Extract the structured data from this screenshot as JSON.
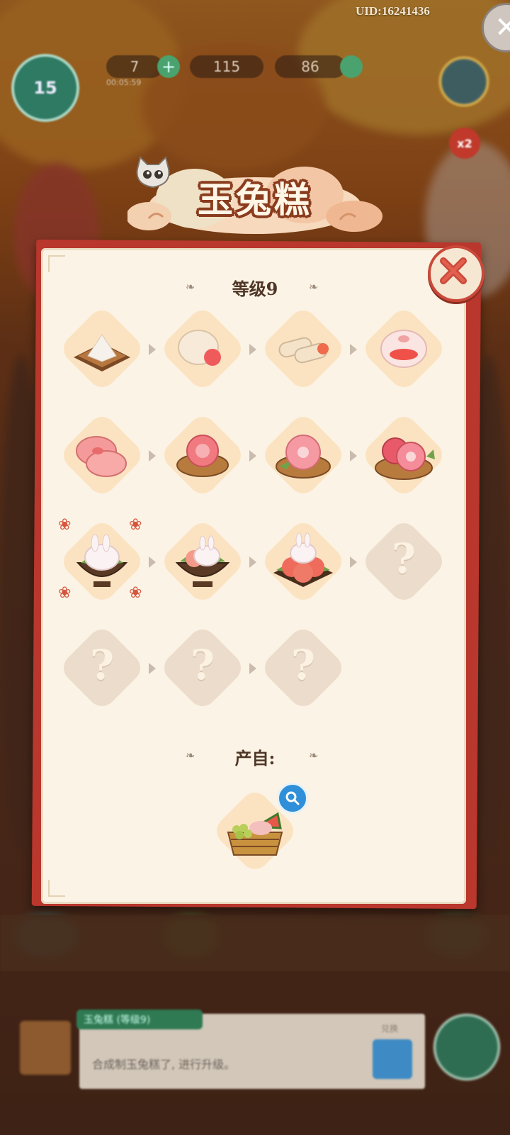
{
  "hud": {
    "uid": "UID:16241436",
    "level": "15",
    "energy": "7",
    "energy_timer": "00:05:59",
    "coins": "115",
    "gems": "86",
    "boost": "x2"
  },
  "popup": {
    "title": "玉兔糕",
    "level_label": "等级9",
    "source_label": "产自:",
    "chain": [
      {
        "name": "rice-flour-tray",
        "known": true
      },
      {
        "name": "white-dough-bun",
        "known": true
      },
      {
        "name": "rice-roll",
        "known": true
      },
      {
        "name": "pig-face-mochi",
        "known": true
      },
      {
        "name": "pink-pig-cakes",
        "known": true
      },
      {
        "name": "peach-blossom-cake",
        "known": true
      },
      {
        "name": "flower-cake-plate",
        "known": true
      },
      {
        "name": "double-flower-cake",
        "known": true
      },
      {
        "name": "jade-rabbit-cake-bowl",
        "known": true,
        "selected": true
      },
      {
        "name": "rabbit-peach-cake-bowl",
        "known": true
      },
      {
        "name": "rabbit-peach-platter",
        "known": true
      },
      {
        "name": "unknown-item-12",
        "known": false
      },
      {
        "name": "unknown-item-13",
        "known": false
      },
      {
        "name": "unknown-item-14",
        "known": false
      },
      {
        "name": "unknown-item-15",
        "known": false
      }
    ],
    "unknown_symbol": "?",
    "source_item": "fruit-basket-producer"
  },
  "chat": {
    "tag": "玉兔糕 (等级9)",
    "text": "合成制玉兔糕了, 进行升级。",
    "side_label": "兑换"
  },
  "colors": {
    "panel_bg": "#fbf3e5",
    "panel_border": "#b9372d",
    "accent_red": "#c9493a",
    "title_outline": "#8a3c1e"
  }
}
